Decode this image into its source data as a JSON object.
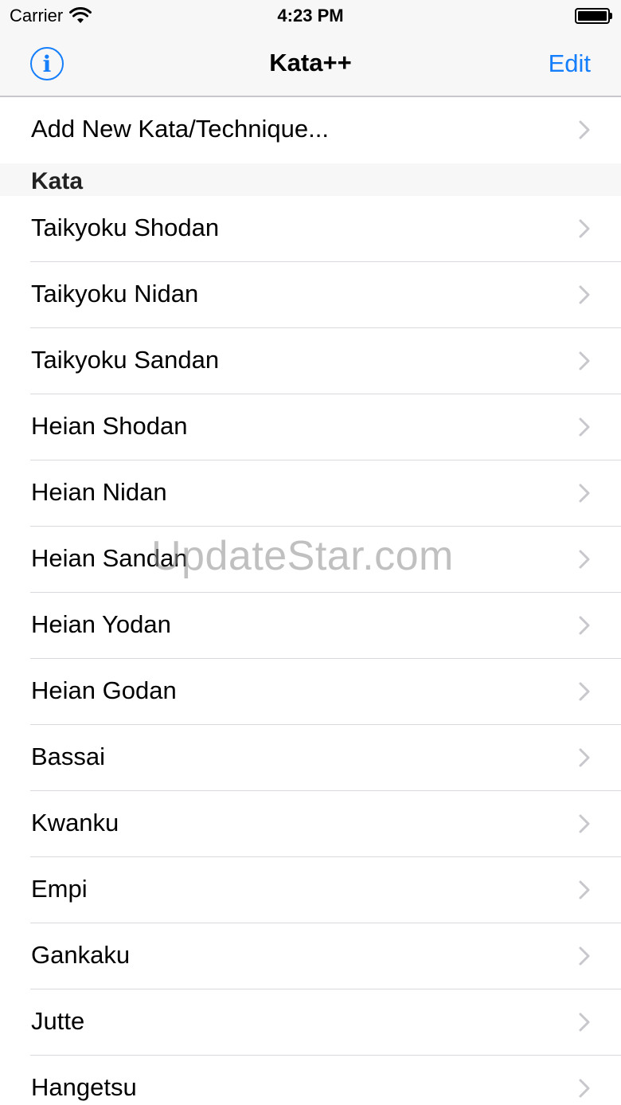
{
  "status_bar": {
    "carrier": "Carrier",
    "time": "4:23 PM"
  },
  "nav": {
    "title": "Kata++",
    "edit_label": "Edit",
    "info_label": "i"
  },
  "add_row": {
    "label": "Add New Kata/Technique..."
  },
  "section": {
    "header": "Kata",
    "items": [
      {
        "label": "Taikyoku Shodan"
      },
      {
        "label": "Taikyoku Nidan"
      },
      {
        "label": "Taikyoku Sandan"
      },
      {
        "label": "Heian Shodan"
      },
      {
        "label": "Heian Nidan"
      },
      {
        "label": "Heian Sandan"
      },
      {
        "label": "Heian Yodan"
      },
      {
        "label": "Heian Godan"
      },
      {
        "label": "Bassai"
      },
      {
        "label": "Kwanku"
      },
      {
        "label": "Empi"
      },
      {
        "label": "Gankaku"
      },
      {
        "label": "Jutte"
      },
      {
        "label": "Hangetsu"
      }
    ]
  },
  "watermark": "UpdateStar.com",
  "colors": {
    "accent": "#147efb",
    "chevron": "#c7c7cc",
    "separator": "#d9d9dd",
    "bar_background": "#f7f7f7"
  }
}
